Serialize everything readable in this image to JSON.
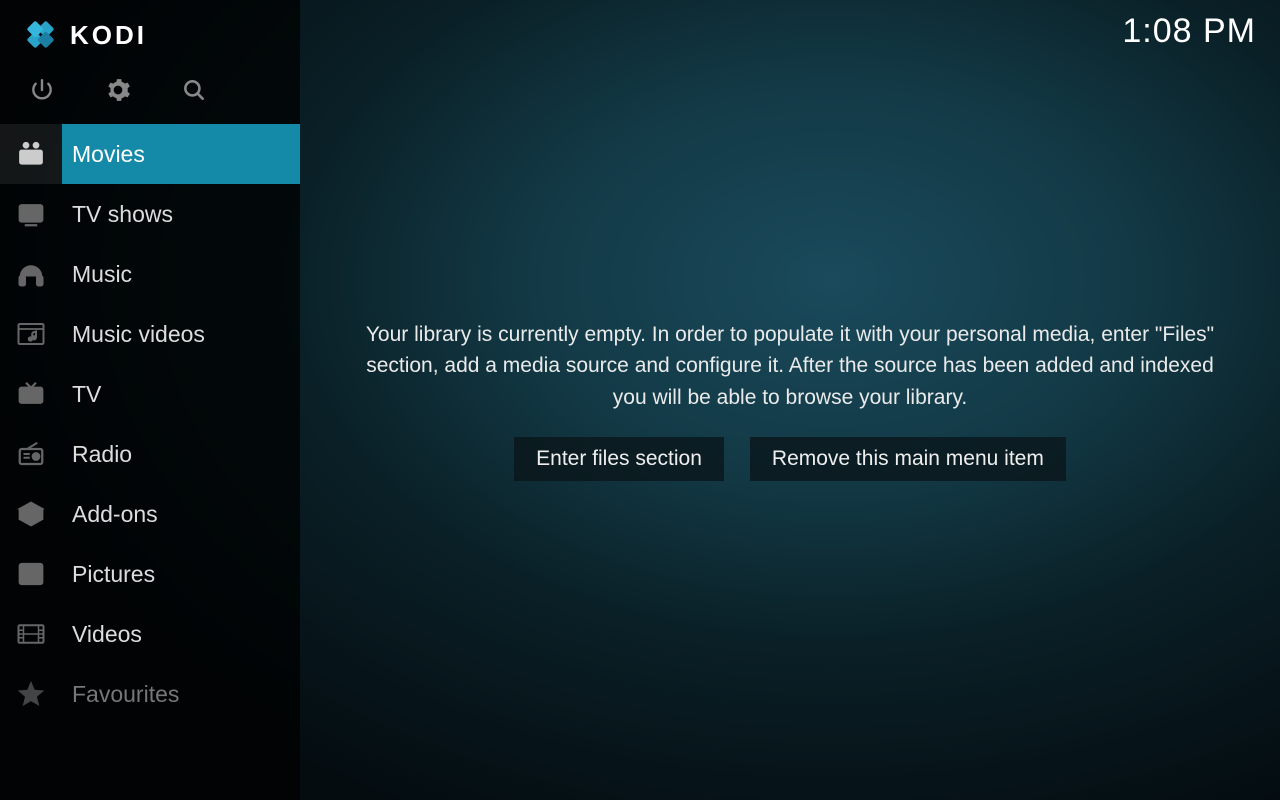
{
  "clock": "1:08 PM",
  "app_name": "KODI",
  "sidebar": {
    "items": [
      {
        "label": "Movies",
        "icon": "movies",
        "active": true
      },
      {
        "label": "TV shows",
        "icon": "tvshows",
        "active": false
      },
      {
        "label": "Music",
        "icon": "music",
        "active": false
      },
      {
        "label": "Music videos",
        "icon": "musicvid",
        "active": false
      },
      {
        "label": "TV",
        "icon": "tv",
        "active": false
      },
      {
        "label": "Radio",
        "icon": "radio",
        "active": false
      },
      {
        "label": "Add-ons",
        "icon": "addons",
        "active": false
      },
      {
        "label": "Pictures",
        "icon": "pictures",
        "active": false
      },
      {
        "label": "Videos",
        "icon": "videos",
        "active": false
      },
      {
        "label": "Favourites",
        "icon": "fav",
        "active": false,
        "dim": true
      }
    ]
  },
  "main": {
    "empty_message": "Your library is currently empty. In order to populate it with your personal media, enter \"Files\" section, add a media source and configure it. After the source has been added and indexed you will be able to browse your library.",
    "buttons": {
      "enter_files": "Enter files section",
      "remove_item": "Remove this main menu item"
    }
  }
}
